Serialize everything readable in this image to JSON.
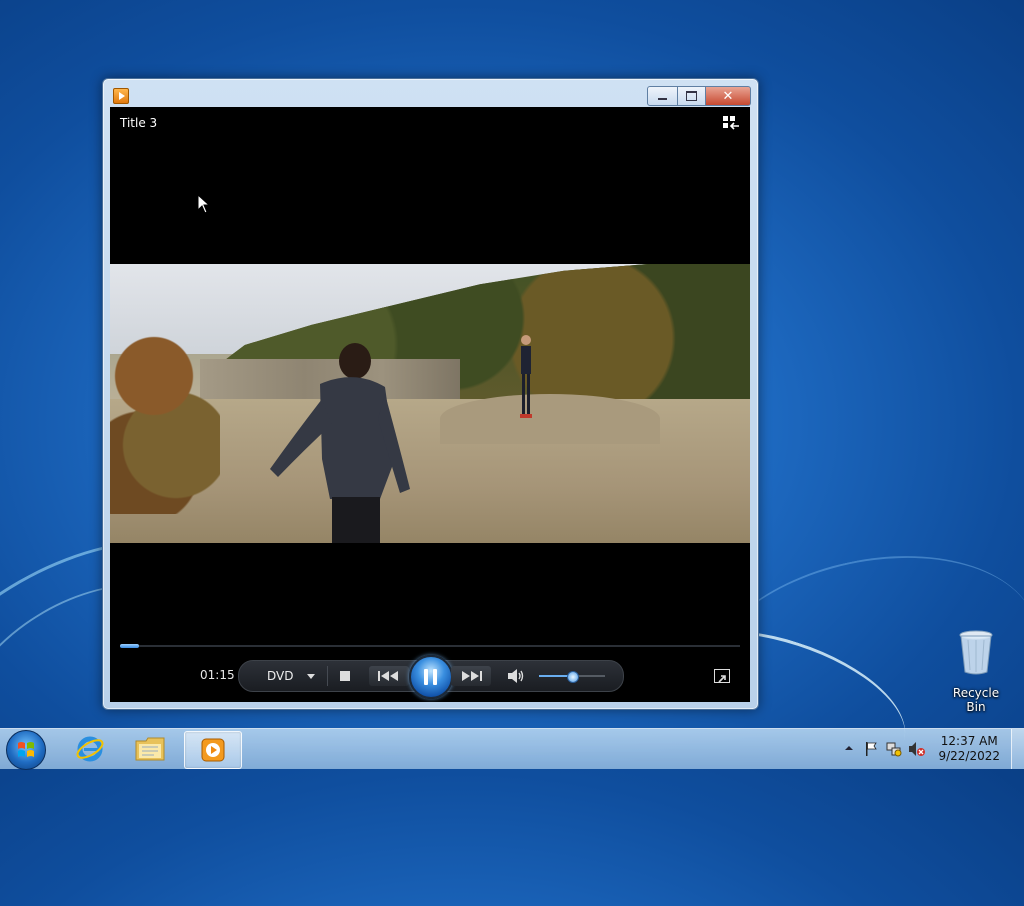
{
  "window": {
    "title_overlay": "Title 3",
    "controls": {
      "minimize": "minimize",
      "maximize": "maximize",
      "close": "close"
    }
  },
  "player": {
    "elapsed_time": "01:15",
    "source_label": "DVD",
    "seek_progress_fraction": 0.03,
    "volume_fraction": 0.5,
    "state": "playing"
  },
  "desktop": {
    "icons": [
      {
        "label": "Recycle Bin",
        "icon": "recycle-bin-icon"
      }
    ]
  },
  "taskbar": {
    "pinned": [
      {
        "name": "internet-explorer",
        "icon": "ie-icon"
      },
      {
        "name": "windows-explorer",
        "icon": "folder-icon"
      },
      {
        "name": "windows-media-player",
        "icon": "media-player-icon",
        "active": true
      }
    ],
    "clock": {
      "time": "12:37 AM",
      "date": "9/22/2022"
    }
  },
  "colors": {
    "accent": "#3a8fe0",
    "desktop_bg": "#1f6cc4",
    "close_button": "#c74a31"
  }
}
